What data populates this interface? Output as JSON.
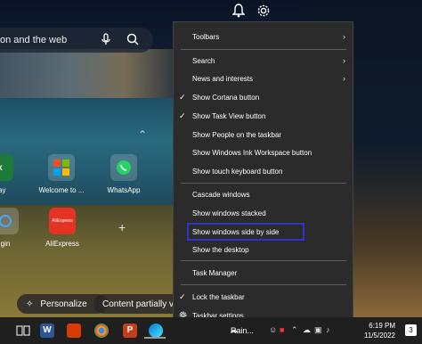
{
  "search": {
    "text": "on and the web"
  },
  "tiles": [
    {
      "label": "bay"
    },
    {
      "label": "Welcome to ..."
    },
    {
      "label": "WhatsApp"
    },
    {
      "label": "gin"
    },
    {
      "label": "AliExpress"
    }
  ],
  "pills": {
    "personalize": "Personalize",
    "content": "Content partially visi"
  },
  "menu": {
    "items": [
      {
        "label": "Toolbars",
        "checked": false,
        "submenu": true
      },
      {
        "label": "Search",
        "checked": false,
        "submenu": true
      },
      {
        "label": "News and interests",
        "checked": false,
        "submenu": true
      },
      {
        "label": "Show Cortana button",
        "checked": true,
        "submenu": false
      },
      {
        "label": "Show Task View button",
        "checked": true,
        "submenu": false
      },
      {
        "label": "Show People on the taskbar",
        "checked": false,
        "submenu": false
      },
      {
        "label": "Show Windows Ink Workspace button",
        "checked": false,
        "submenu": false
      },
      {
        "label": "Show touch keyboard button",
        "checked": false,
        "submenu": false
      },
      {
        "label": "Cascade windows",
        "checked": false,
        "submenu": false
      },
      {
        "label": "Show windows stacked",
        "checked": false,
        "submenu": false
      },
      {
        "label": "Show windows side by side",
        "checked": false,
        "submenu": false,
        "highlighted": true
      },
      {
        "label": "Show the desktop",
        "checked": false,
        "submenu": false
      },
      {
        "label": "Task Manager",
        "checked": false,
        "submenu": false
      },
      {
        "label": "Lock the taskbar",
        "checked": true,
        "submenu": false
      },
      {
        "label": "Taskbar settings",
        "checked": false,
        "submenu": false,
        "icon": "gear-icon"
      }
    ]
  },
  "taskbar": {
    "weather": "Rain...",
    "time": "6:19 PM",
    "date": "11/5/2022",
    "notifications": "3"
  },
  "colors": {
    "highlight_border": "#2d35c8",
    "menu_bg": "#2b2b2b"
  }
}
